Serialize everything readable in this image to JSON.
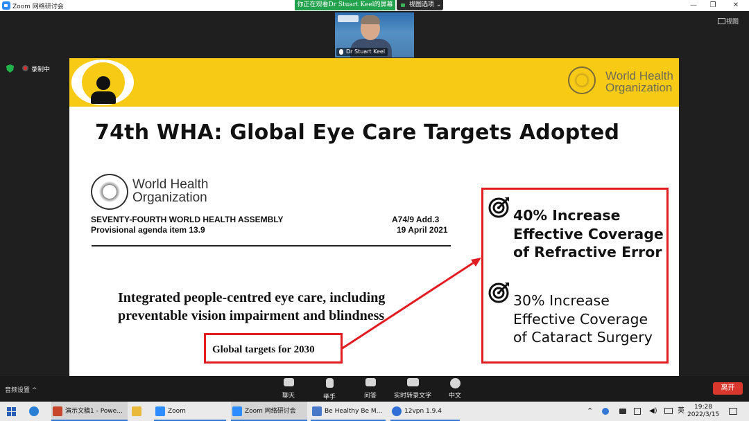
{
  "window": {
    "title": "Zoom 网络研讨会",
    "minimize": "—",
    "maximize": "❐",
    "close": "✕"
  },
  "share_notice": "你正在观看Dr Stuart  Keel的屏幕",
  "view_options": "视图选项 ⌄",
  "speaker": {
    "name": "Dr Stuart Keel"
  },
  "recording_label": "录制中",
  "view_label": "视图",
  "slide": {
    "title": "74th WHA: Global Eye Care Targets Adopted",
    "who_logo_line1": "World Health",
    "who_logo_line2": "Organization",
    "doc_logo_line1": "World Health",
    "doc_logo_line2": "Organization",
    "assembly": "SEVENTY-FOURTH WORLD HEALTH ASSEMBLY",
    "agenda_item": "Provisional agenda item 13.9",
    "doc_number": "A74/9 Add.3",
    "doc_date": "19 April 2021",
    "heading_line1": "Integrated people-centred eye care, including",
    "heading_line2": "preventable vision impairment and blindness",
    "targets_label": "Global targets for 2030",
    "goal1": [
      "40% Increase",
      "Effective Coverage",
      "of Refractive Error"
    ],
    "goal2": [
      "30% Increase",
      "Effective Coverage",
      "of Cataract Surgery"
    ]
  },
  "toolbar": {
    "audio_settings": "音频设置  ^",
    "chat": "聊天",
    "raise_hand": "举手",
    "qa": "问答",
    "captions": "实时转录文字",
    "language": "中文",
    "leave": "离开"
  },
  "taskbar": {
    "items": [
      "演示文稿1 - Powe...",
      "Zoom",
      "Zoom 网络研讨会",
      "Be Healthy Be M...",
      "12vpn 1.9.4"
    ],
    "ime": "英",
    "time": "19:28",
    "date": "2022/3/15"
  },
  "colors": {
    "slide_band": "#f7cb15",
    "highlight_red": "#e11d22",
    "share_green": "#23a24d",
    "leave_red": "#d8372d",
    "who_blue": "#5b92c6"
  }
}
